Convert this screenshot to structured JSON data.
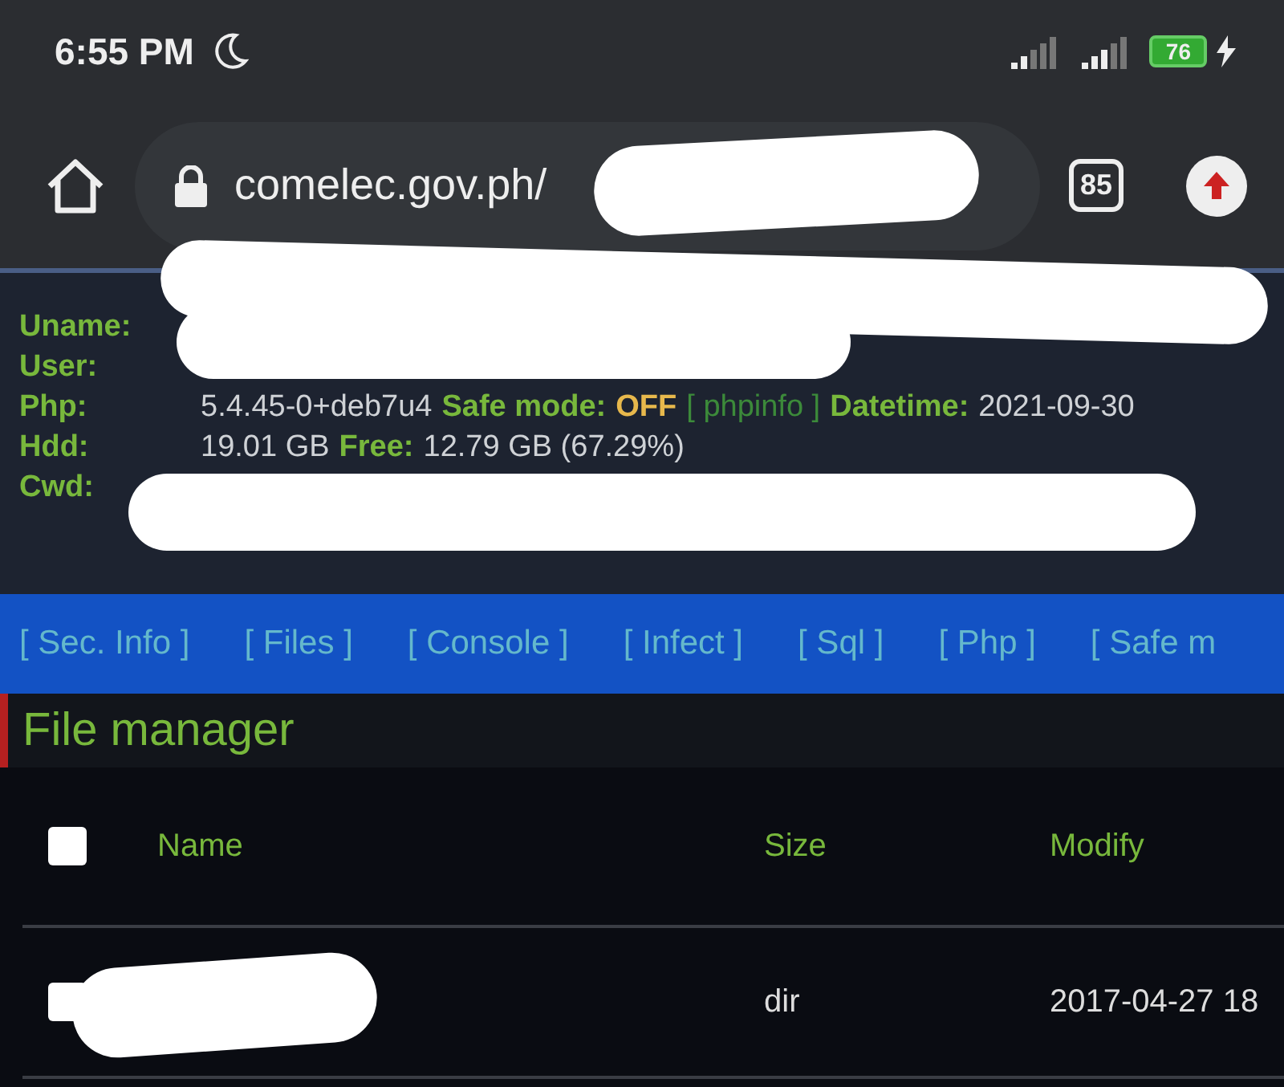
{
  "status_bar": {
    "time": "6:55 PM",
    "battery": "76"
  },
  "address_bar": {
    "url": "comelec.gov.ph/",
    "tab_count": "85"
  },
  "info": [
    {
      "label": "Uname:"
    },
    {
      "label": "User:"
    },
    {
      "label": "Php:",
      "parts": [
        {
          "text": "5.4.45-0+deb7u4",
          "kind": "value"
        },
        {
          "text": "Safe mode:",
          "kind": "key"
        },
        {
          "text": "OFF",
          "kind": "warn"
        },
        {
          "text": "[ phpinfo ]",
          "kind": "link"
        },
        {
          "text": "Datetime:",
          "kind": "key"
        },
        {
          "text": "2021-09-30",
          "kind": "value"
        }
      ]
    },
    {
      "label": "Hdd:",
      "parts": [
        {
          "text": "19.01 GB",
          "kind": "value"
        },
        {
          "text": "Free:",
          "kind": "key"
        },
        {
          "text": "12.79 GB (67.29%)",
          "kind": "value"
        }
      ]
    },
    {
      "label": "Cwd:"
    }
  ],
  "nav": [
    "[ Sec. Info ]",
    "[ Files ]",
    "[ Console ]",
    "[ Infect ]",
    "[ Sql ]",
    "[ Php ]",
    "[ Safe m"
  ],
  "section_title": "File manager",
  "table": {
    "select_all": {
      "checked": false
    },
    "columns": [
      "Name",
      "Size",
      "Modify"
    ],
    "rows": [
      {
        "checked": false,
        "size": "dir",
        "modify": "2017-04-27 18"
      }
    ]
  }
}
